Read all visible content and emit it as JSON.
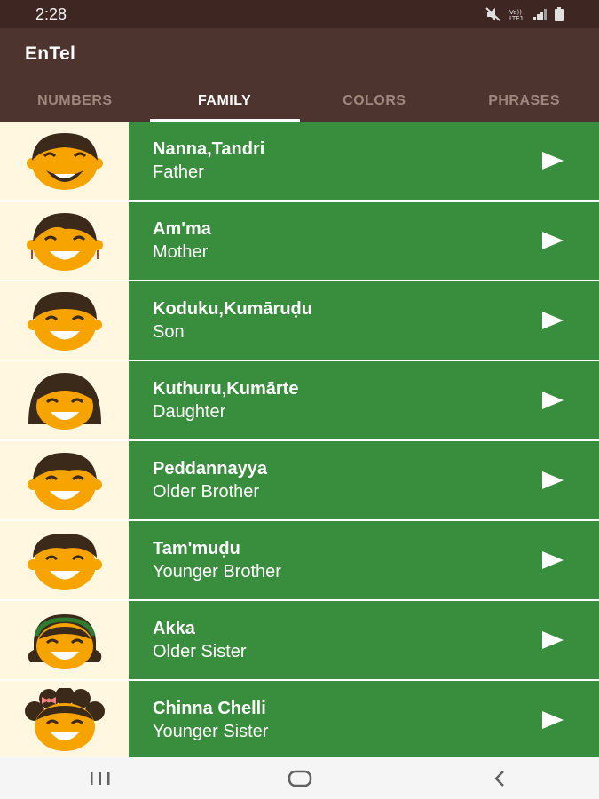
{
  "status_bar": {
    "time": "2:28",
    "network_label": "Vo))\nLTE1"
  },
  "app_bar": {
    "title": "EnTel"
  },
  "tabs": [
    {
      "label": "NUMBERS",
      "active": false
    },
    {
      "label": "FAMILY",
      "active": true
    },
    {
      "label": "COLORS",
      "active": false
    },
    {
      "label": "PHRASES",
      "active": false
    }
  ],
  "colors": {
    "status_bar": "#3e2723",
    "app_bar": "#4e342e",
    "row_background": "#388e3c",
    "icon_background": "#fff7e0",
    "face": "#f7a400",
    "hair": "#3b2a1a"
  },
  "family_items": [
    {
      "word": "Nanna,Tandri",
      "translation": "Father",
      "icon": "father-icon"
    },
    {
      "word": "Am'ma",
      "translation": "Mother",
      "icon": "mother-icon"
    },
    {
      "word": "Koduku,Kumāruḍu",
      "translation": "Son",
      "icon": "son-icon"
    },
    {
      "word": "Kuthuru,Kumārte",
      "translation": "Daughter",
      "icon": "daughter-icon"
    },
    {
      "word": "Peddannayya",
      "translation": "Older Brother",
      "icon": "older-brother-icon"
    },
    {
      "word": "Tam'muḍu",
      "translation": "Younger Brother",
      "icon": "younger-brother-icon"
    },
    {
      "word": "Akka",
      "translation": "Older Sister",
      "icon": "older-sister-icon"
    },
    {
      "word": "Chinna Chelli",
      "translation": "Younger Sister",
      "icon": "younger-sister-icon"
    }
  ],
  "nav_bar": {
    "buttons": [
      "recent-apps-icon",
      "home-icon",
      "back-icon"
    ]
  }
}
